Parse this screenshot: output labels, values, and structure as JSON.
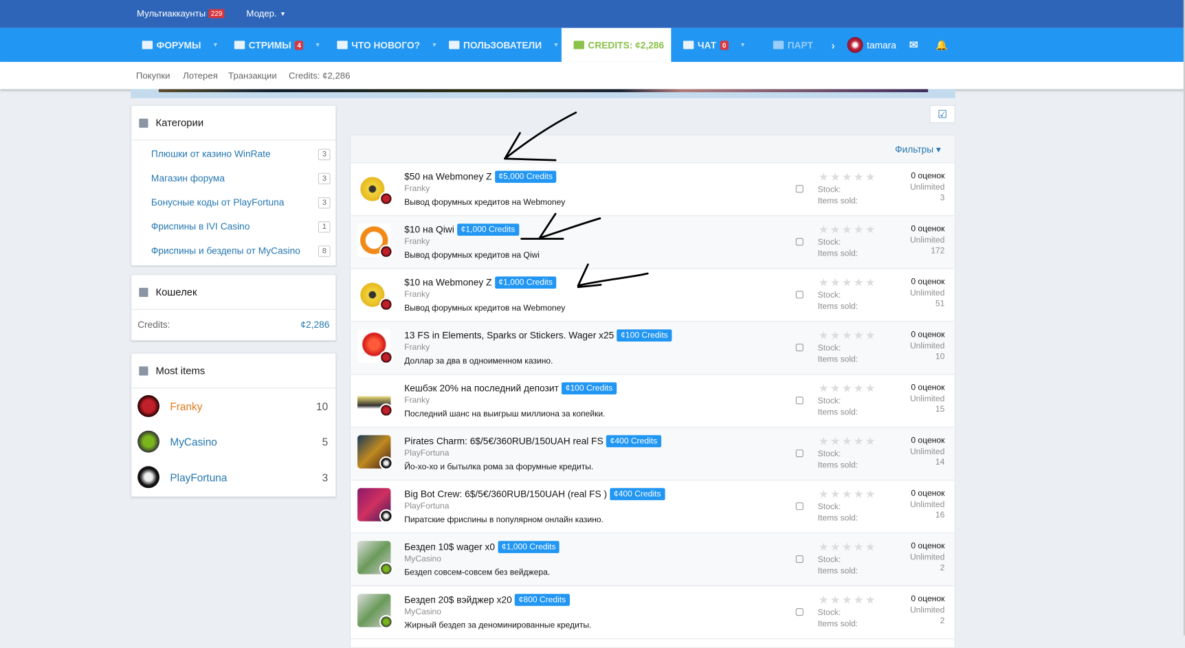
{
  "topbar": {
    "multi": "Мультиаккаунты",
    "multi_count": "229",
    "moder": "Модер."
  },
  "nav": {
    "forums": "ФОРУМЫ",
    "streams": "СТРИМЫ",
    "streams_count": "4",
    "whatsnew": "ЧТО НОВОГО?",
    "users": "ПОЛЬЗОВАТЕЛИ",
    "credits": "CREDITS: ¢2,286",
    "chat": "ЧАТ",
    "chat_count": "0",
    "partners": "ПАРТ",
    "username": "tamara"
  },
  "subnav": [
    "Покупки",
    "Лотерея",
    "Транзакции",
    "Credits: ¢2,286"
  ],
  "categories": {
    "title": "Категории",
    "items": [
      {
        "label": "Плюшки от казино WinRate",
        "count": "3"
      },
      {
        "label": "Магазин форума",
        "count": "3"
      },
      {
        "label": "Бонусные коды от PlayFortuna",
        "count": "3"
      },
      {
        "label": "Фриспины в IVI Casino",
        "count": "1"
      },
      {
        "label": "Фриспины и бездепы от MyCasino",
        "count": "8"
      }
    ]
  },
  "wallet": {
    "title": "Кошелек",
    "label": "Credits:",
    "value": "¢2,286"
  },
  "most": {
    "title": "Most items",
    "items": [
      {
        "name": "Franky",
        "count": "10"
      },
      {
        "name": "MyCasino",
        "count": "5"
      },
      {
        "name": "PlayFortuna",
        "count": "3"
      }
    ]
  },
  "filters": "Фильтры",
  "labels": {
    "stock": "Stock:",
    "sold": "Items sold:",
    "unlimited": "Unlimited",
    "reviews": "0 оценок"
  },
  "items": [
    {
      "title": "$50 на Webmoney Z",
      "price": "¢5,000 Credits",
      "author": "Franky",
      "desc": "Вывод форумных кредитов на Webmoney",
      "sold": "3"
    },
    {
      "title": "$10 на Qiwi",
      "price": "¢1,000 Credits",
      "author": "Franky",
      "desc": "Вывод форумных кредитов на Qiwi",
      "sold": "172"
    },
    {
      "title": "$10 на Webmoney Z",
      "price": "¢1,000 Credits",
      "author": "Franky",
      "desc": "Вывод форумных кредитов на Webmoney",
      "sold": "51"
    },
    {
      "title": "13 FS in Elements, Sparks or Stickers. Wager x25",
      "price": "¢100 Credits",
      "author": "Franky",
      "desc": "Доллар за два в одноименном казино.",
      "sold": "10"
    },
    {
      "title": "Кешбэк 20% на последний депозит",
      "price": "¢100 Credits",
      "author": "Franky",
      "desc": "Последний шанс на выигрыш миллиона за копейки.",
      "sold": "15"
    },
    {
      "title": "Pirates Charm: 6$/5€/360RUB/150UAH real FS",
      "price": "¢400 Credits",
      "author": "PlayFortuna",
      "desc": "Йо-хо-хо и бытылка рома за форумные кредиты.",
      "sold": "14"
    },
    {
      "title": "Big Bot Crew: 6$/5€/360RUB/150UAH (real FS )",
      "price": "¢400 Credits",
      "author": "PlayFortuna",
      "desc": "Пиратские фриспины в популярном онлайн казино.",
      "sold": "16"
    },
    {
      "title": "Бездеп 10$ wager x0",
      "price": "¢1,000 Credits",
      "author": "MyCasino",
      "desc": "Бездеп совсем-совсем без вейджера.",
      "sold": "2"
    },
    {
      "title": "Бездеп 20$ вэйджер x20",
      "price": "¢800 Credits",
      "author": "MyCasino",
      "desc": "Жирный бездеп за деноминированные кредиты.",
      "sold": "2"
    }
  ]
}
